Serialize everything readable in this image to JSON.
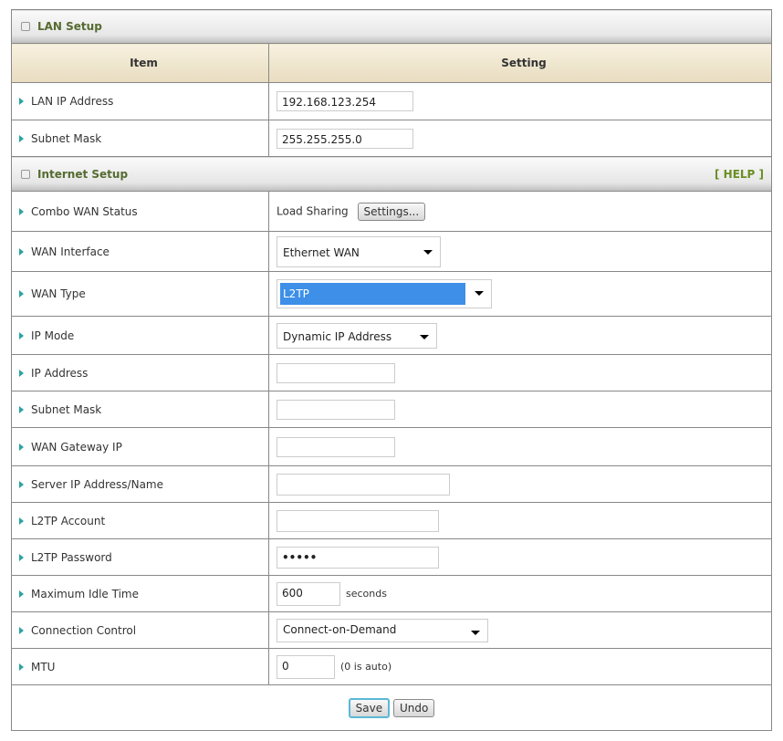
{
  "lan": {
    "title": "LAN Setup",
    "col_item": "Item",
    "col_setting": "Setting",
    "ip_label": "LAN IP Address",
    "ip_value": "192.168.123.254",
    "mask_label": "Subnet Mask",
    "mask_value": "255.255.255.0"
  },
  "internet": {
    "title": "Internet Setup",
    "help": "[ HELP ]",
    "rows": {
      "combo": {
        "label": "Combo WAN Status",
        "value": "Load Sharing",
        "button": "Settings..."
      },
      "wan_if": {
        "label": "WAN Interface",
        "value": "Ethernet WAN"
      },
      "wan_type": {
        "label": "WAN Type",
        "value": "L2TP"
      },
      "ip_mode": {
        "label": "IP Mode",
        "value": "Dynamic IP Address"
      },
      "ip": {
        "label": "IP Address",
        "value": ""
      },
      "mask": {
        "label": "Subnet Mask",
        "value": ""
      },
      "gw": {
        "label": "WAN Gateway IP",
        "value": ""
      },
      "server": {
        "label": "Server IP Address/Name",
        "value": ""
      },
      "account": {
        "label": "L2TP Account",
        "value": ""
      },
      "password": {
        "label": "L2TP Password",
        "value": "•••••"
      },
      "idle": {
        "label": "Maximum Idle Time",
        "value": "600",
        "suffix": "seconds"
      },
      "conn": {
        "label": "Connection Control",
        "value": "Connect-on-Demand"
      },
      "mtu": {
        "label": "MTU",
        "value": "0",
        "suffix": "(0 is auto)"
      }
    }
  },
  "actions": {
    "save": "Save",
    "undo": "Undo"
  },
  "colors": {
    "accent_select": "#3d8fe8",
    "section_title": "#556b2f"
  }
}
